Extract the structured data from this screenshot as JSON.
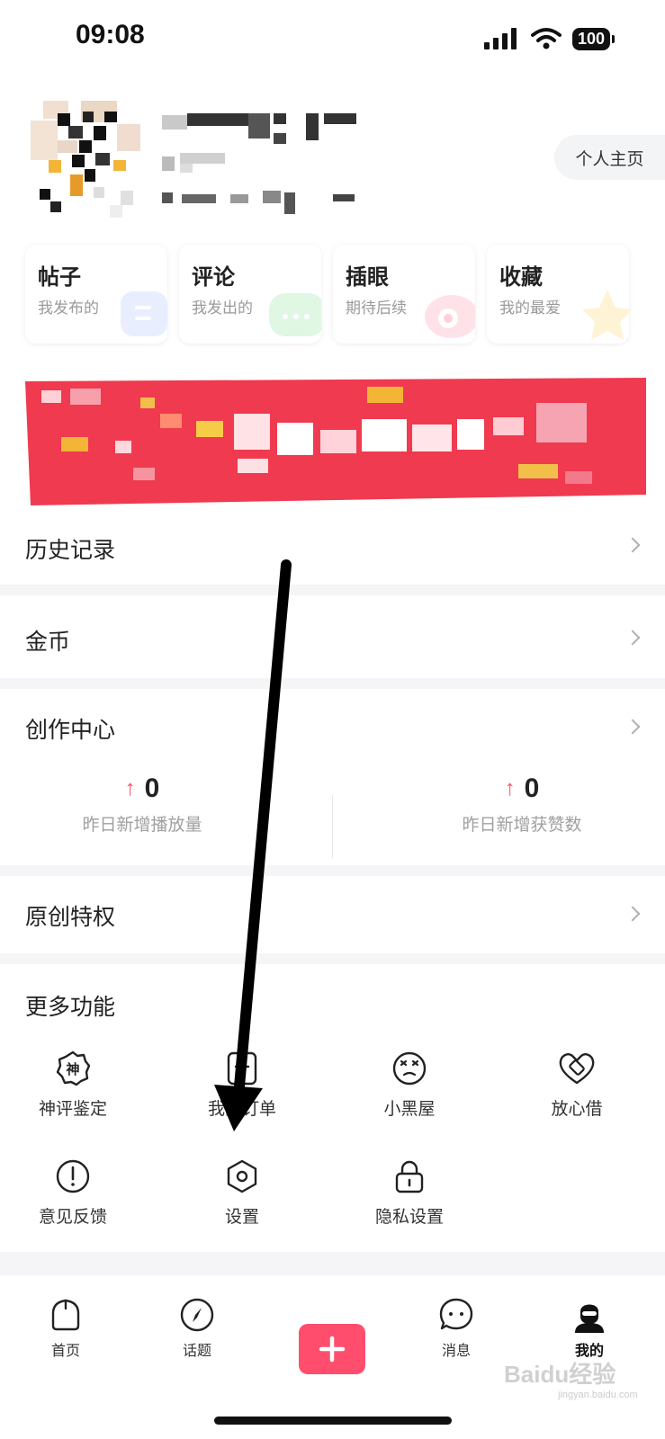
{
  "status_bar": {
    "time": "09:08",
    "battery": "100"
  },
  "profile": {
    "home_button": "个人主页"
  },
  "quick_cards": [
    {
      "title": "帖子",
      "subtitle": "我发布的",
      "accent": "#e8edff"
    },
    {
      "title": "评论",
      "subtitle": "我发出的",
      "accent": "#e3f9e6"
    },
    {
      "title": "插眼",
      "subtitle": "期待后续",
      "accent": "#ffe6ea"
    },
    {
      "title": "收藏",
      "subtitle": "我的最爱",
      "accent": "#fff6dd"
    }
  ],
  "banner": {
    "color": "#ef3a4f"
  },
  "menu": {
    "history": "历史记录",
    "coins": "金币",
    "creation": {
      "title": "创作中心",
      "stats": [
        {
          "value": "0",
          "label": "昨日新增播放量"
        },
        {
          "value": "0",
          "label": "昨日新增获赞数"
        }
      ]
    },
    "original": "原创特权",
    "more": {
      "title": "更多功能",
      "items": [
        {
          "label": "神评鉴定",
          "icon": "shen-badge-icon"
        },
        {
          "label": "我的订单",
          "icon": "order-icon"
        },
        {
          "label": "小黑屋",
          "icon": "dizzy-face-icon"
        },
        {
          "label": "放心借",
          "icon": "heart-coin-icon"
        },
        {
          "label": "意见反馈",
          "icon": "exclamation-circle-icon"
        },
        {
          "label": "设置",
          "icon": "hexagon-settings-icon"
        },
        {
          "label": "隐私设置",
          "icon": "lock-icon"
        }
      ]
    }
  },
  "tabbar": {
    "publish_icon": "plus-icon",
    "tabs": [
      {
        "label": "首页",
        "icon": "home-icon"
      },
      {
        "label": "话题",
        "icon": "compass-icon"
      },
      {
        "label": "消息",
        "icon": "chat-bubble-icon"
      },
      {
        "label": "我的",
        "icon": "user-avatar-icon",
        "active": true
      }
    ]
  },
  "colors": {
    "accent": "#ff4d6d",
    "separator": "#f5f5f7"
  },
  "watermark": {
    "brand": "Baidu经验",
    "url": "jingyan.baidu.com"
  }
}
